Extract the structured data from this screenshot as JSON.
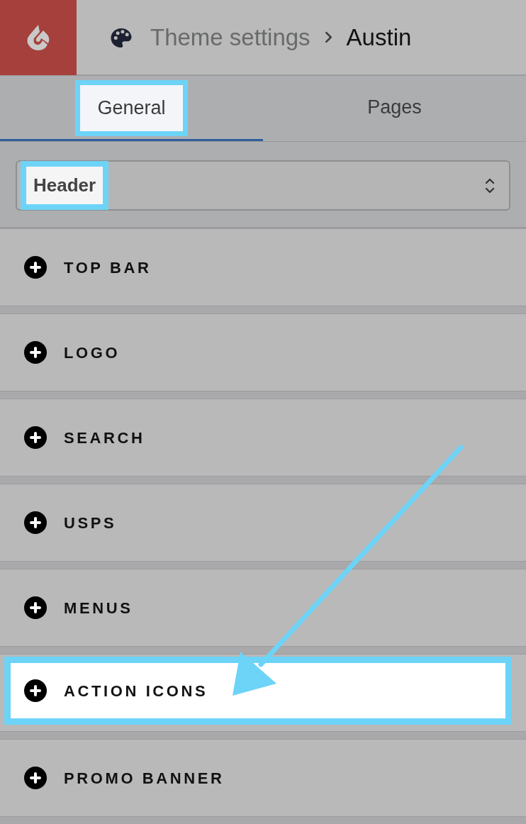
{
  "header": {
    "title": "Theme settings",
    "current": "Austin"
  },
  "tabs": [
    {
      "label": "General",
      "selected": true,
      "highlighted": true
    },
    {
      "label": "Pages",
      "selected": false,
      "highlighted": false
    }
  ],
  "section_select": {
    "value": "Header",
    "highlighted": true
  },
  "sections": [
    {
      "label": "TOP BAR",
      "expanded": false,
      "highlighted": false,
      "pointed_at": false
    },
    {
      "label": "LOGO",
      "expanded": false,
      "highlighted": false,
      "pointed_at": false
    },
    {
      "label": "SEARCH",
      "expanded": false,
      "highlighted": false,
      "pointed_at": false
    },
    {
      "label": "USPS",
      "expanded": false,
      "highlighted": false,
      "pointed_at": false
    },
    {
      "label": "MENUS",
      "expanded": false,
      "highlighted": false,
      "pointed_at": false
    },
    {
      "label": "ACTION ICONS",
      "expanded": false,
      "highlighted": true,
      "pointed_at": true
    },
    {
      "label": "PROMO BANNER",
      "expanded": false,
      "highlighted": false,
      "pointed_at": false
    }
  ]
}
